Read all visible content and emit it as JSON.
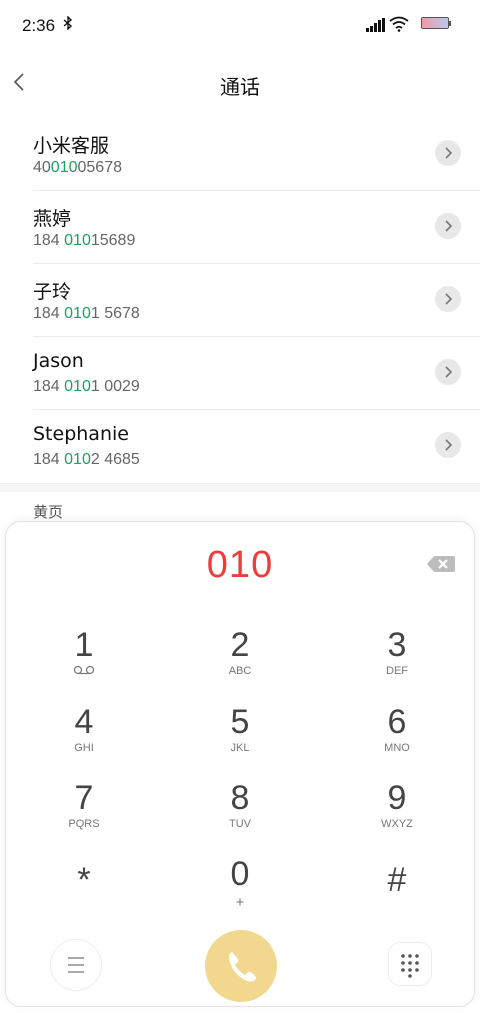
{
  "status_bar": {
    "time": "2:36",
    "bluetooth_icon": "bluetooth-icon",
    "signal_icon": "signal-icon",
    "wifi_icon": "wifi-icon",
    "battery_icon": "battery-icon"
  },
  "header": {
    "title": "通话",
    "back_icon": "chevron-left-icon"
  },
  "contacts": [
    {
      "name": "小米客服",
      "num_pre": "40",
      "num_hl": "010",
      "num_post": "05678"
    },
    {
      "name": "燕婷",
      "num_pre": "184 ",
      "num_hl": "010",
      "num_post": "15689"
    },
    {
      "name": "子玲",
      "num_pre": "184 ",
      "num_hl": "010",
      "num_post": "1 5678"
    },
    {
      "name": "Jason",
      "num_pre": "184 ",
      "num_hl": "010",
      "num_post": "1 0029"
    },
    {
      "name": "Stephanie",
      "num_pre": "184 ",
      "num_hl": "010",
      "num_post": "2 4685"
    }
  ],
  "section": {
    "yellow_pages": "黄页"
  },
  "dialer": {
    "display": "010",
    "keys": [
      {
        "digit": "1",
        "letters": ""
      },
      {
        "digit": "2",
        "letters": "ABC"
      },
      {
        "digit": "3",
        "letters": "DEF"
      },
      {
        "digit": "4",
        "letters": "GHI"
      },
      {
        "digit": "5",
        "letters": "JKL"
      },
      {
        "digit": "6",
        "letters": "MNO"
      },
      {
        "digit": "7",
        "letters": "PQRS"
      },
      {
        "digit": "8",
        "letters": "TUV"
      },
      {
        "digit": "9",
        "letters": "WXYZ"
      },
      {
        "digit": "*",
        "letters": ""
      },
      {
        "digit": "0",
        "letters": "+"
      },
      {
        "digit": "#",
        "letters": ""
      }
    ]
  },
  "colors": {
    "highlight": "#1aa260",
    "display": "#ef3b3b",
    "call_button": "#f1d88e"
  }
}
